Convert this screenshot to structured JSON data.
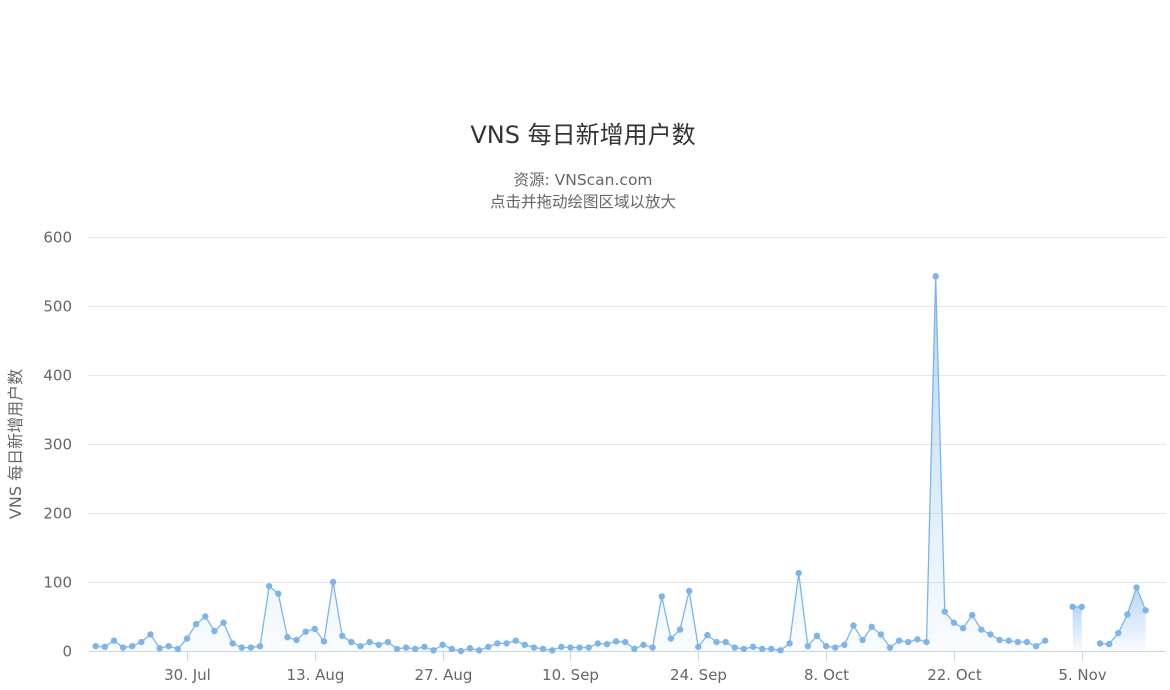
{
  "chart_data": {
    "type": "area",
    "title": "VNS 每日新增用户数",
    "subtitle_lines": [
      "资源: VNScan.com",
      "点击并拖动绘图区域以放大"
    ],
    "ylabel": "VNS 每日新增用户数",
    "xlabel": "",
    "ylim": [
      0,
      600
    ],
    "y_ticks": [
      0,
      100,
      200,
      300,
      400,
      500,
      600
    ],
    "x_ticks": [
      {
        "label": "30. Jul",
        "date": "2023-07-30"
      },
      {
        "label": "13. Aug",
        "date": "2023-08-13"
      },
      {
        "label": "27. Aug",
        "date": "2023-08-27"
      },
      {
        "label": "10. Sep",
        "date": "2023-09-10"
      },
      {
        "label": "24. Sep",
        "date": "2023-09-24"
      },
      {
        "label": "8. Oct",
        "date": "2023-10-08"
      },
      {
        "label": "22. Oct",
        "date": "2023-10-22"
      },
      {
        "label": "5. Nov",
        "date": "2023-11-05"
      }
    ],
    "grid": true,
    "legend": "none",
    "color": "#7cb5ec",
    "series": [
      {
        "segments": [
          {
            "start_date": "2023-07-20",
            "values": [
              7,
              6,
              15,
              5,
              7,
              13,
              24,
              4,
              7,
              3,
              18,
              39,
              50,
              29,
              41,
              11,
              5,
              5,
              7,
              94,
              83,
              20,
              16,
              28,
              32,
              14,
              100,
              22,
              13,
              7,
              13,
              9,
              13,
              3,
              5,
              3,
              6,
              1,
              9,
              3,
              0,
              4,
              1,
              6,
              11,
              11,
              15,
              9,
              5,
              3,
              1,
              6,
              5,
              5,
              5,
              11,
              10,
              14,
              13,
              3,
              9,
              5,
              79,
              18,
              31,
              87,
              6,
              23,
              13,
              13,
              5,
              3,
              6,
              3,
              3,
              1,
              11,
              113,
              7,
              22,
              7,
              5,
              9,
              37,
              16,
              35,
              24,
              5,
              15,
              13,
              17,
              13,
              543,
              57,
              41,
              33,
              52,
              31,
              24,
              16,
              15,
              13,
              13,
              7,
              15
            ]
          },
          {
            "start_date": "2023-11-04",
            "values": [
              64,
              64
            ]
          },
          {
            "start_date": "2023-11-07",
            "values": [
              11,
              10,
              26,
              53,
              92,
              59
            ]
          }
        ]
      }
    ]
  }
}
